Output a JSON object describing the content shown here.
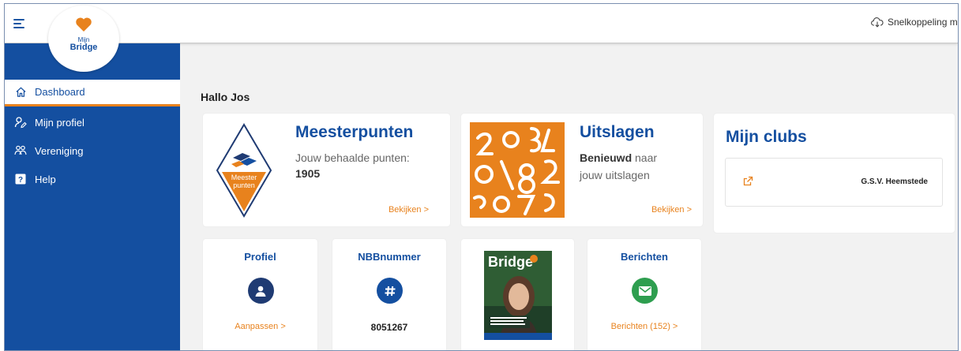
{
  "topbar": {
    "shortcut_label": "Snelkoppeling mak"
  },
  "logo": {
    "line1": "Mijn",
    "line2": "Bridge"
  },
  "sidebar": {
    "items": [
      {
        "label": "Dashboard",
        "icon": "home-icon"
      },
      {
        "label": "Mijn profiel",
        "icon": "user-edit-icon"
      },
      {
        "label": "Vereniging",
        "icon": "group-icon"
      },
      {
        "label": "Help",
        "icon": "help-icon"
      }
    ]
  },
  "main": {
    "greeting": "Hallo Jos",
    "meesterpunten": {
      "title": "Meesterpunten",
      "text": "Jouw behaalde punten:",
      "points": "1905",
      "link": "Bekijken >",
      "logo_text_1": "Meester",
      "logo_text_2": "punten"
    },
    "uitslagen": {
      "title": "Uitslagen",
      "text_bold": "Benieuwd",
      "text_rest": " naar",
      "text_line2": "jouw uitslagen",
      "link": "Bekijken >"
    },
    "clubs": {
      "title": "Mijn clubs",
      "items": [
        {
          "name": "G.S.V. Heemstede"
        }
      ]
    },
    "profiel": {
      "title": "Profiel",
      "link": "Aanpassen >"
    },
    "nbb": {
      "title": "NBBnummer",
      "value": "8051267"
    },
    "magazine": {
      "name": "Bridge"
    },
    "berichten": {
      "title": "Berichten",
      "link": "Berichten (152) >"
    }
  },
  "colors": {
    "primary": "#144fa0",
    "accent": "#e8821d",
    "green": "#2e9e4f",
    "navy": "#1f3b73"
  }
}
